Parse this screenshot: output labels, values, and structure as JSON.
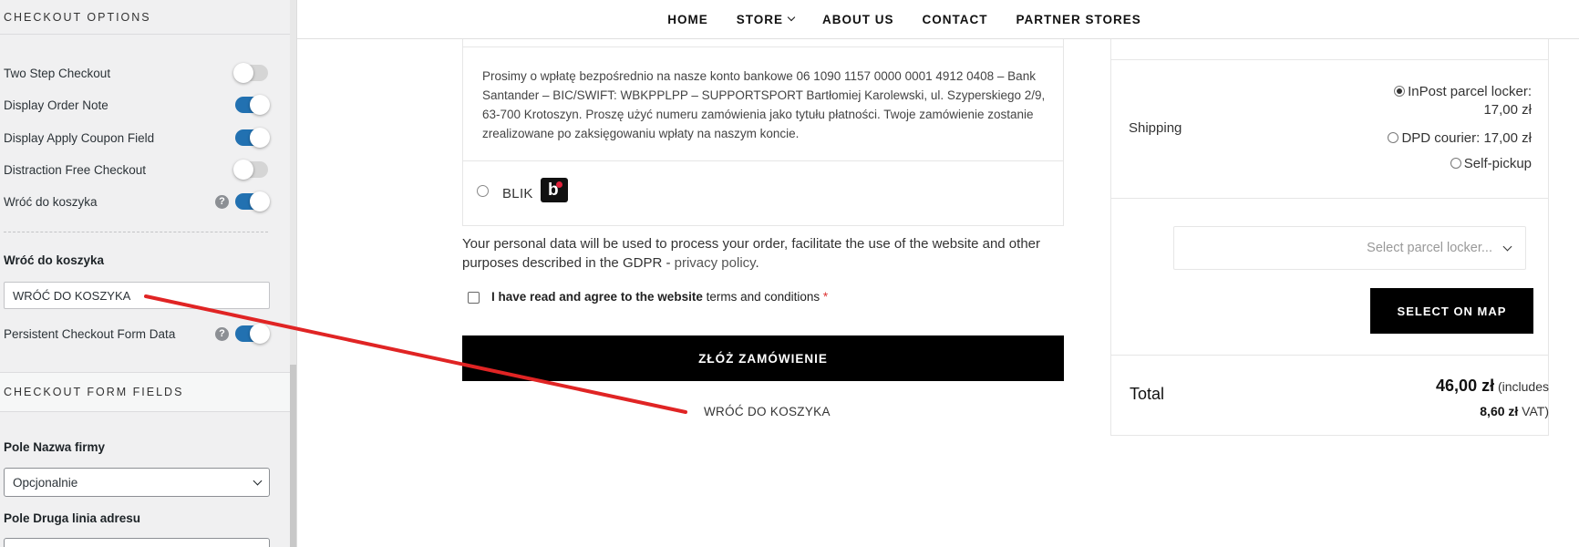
{
  "panel": {
    "section1_title": "CHECKOUT OPTIONS",
    "options": [
      {
        "label": "Two Step Checkout",
        "state": "off"
      },
      {
        "label": "Display Order Note",
        "state": "on"
      },
      {
        "label": "Display Apply Coupon Field",
        "state": "on"
      },
      {
        "label": "Distraction Free Checkout",
        "state": "off"
      },
      {
        "label": "Wróć do koszyka",
        "state": "on",
        "help": "?"
      }
    ],
    "back_field_label": "Wróć do koszyka",
    "back_field_value": "WRÓĆ DO KOSZYKA",
    "persistent_label": "Persistent Checkout Form Data",
    "persistent_state": "on",
    "persistent_help": "?",
    "section2_title": "CHECKOUT FORM FIELDS",
    "company_field_label": "Pole Nazwa firmy",
    "company_field_value": "Opcjonalnie",
    "address2_field_label": "Pole Druga linia adresu"
  },
  "nav": {
    "items": [
      "HOME",
      "STORE",
      "ABOUT US",
      "CONTACT",
      "PARTNER STORES"
    ]
  },
  "payment": {
    "bank_description": "Prosimy o wpłatę bezpośrednio na nasze konto bankowe 06 1090 1157 0000 0001 4912 0408 – Bank Santander – BIC/SWIFT: WBKPPLPP – SUPPORTSPORT Bartłomiej Karolewski, ul. Szyperskiego 2/9, 63-700 Krotoszyn. Proszę użyć numeru zamówienia jako tytułu płatności. Twoje zamówienie zostanie zrealizowane po zaksięgowaniu wpłaty na naszym koncie.",
    "blik_label": "BLIK",
    "blik_logo_letter": "b"
  },
  "privacy": {
    "text": "Your personal data will be used to process your order, facilitate the use of the website and other purposes described in the GDPR - ",
    "link": "privacy policy",
    "end": "."
  },
  "terms": {
    "text": "I have read and agree to the website ",
    "link": "terms and conditions",
    "required": "*"
  },
  "place_order_label": "ZŁÓŻ ZAMÓWIENIE",
  "back_link_label": "WRÓĆ DO KOSZYKA",
  "summary": {
    "shipping_label": "Shipping",
    "shipping_options": [
      {
        "line1": "InPost parcel locker:",
        "line2": "17,00 zł",
        "selected": true
      },
      {
        "line1": "DPD courier: 17,00 zł",
        "selected": false
      },
      {
        "line1": "Self-pickup",
        "selected": false
      }
    ],
    "locker_placeholder": "Select parcel locker...",
    "map_button_label": "SELECT ON MAP",
    "total_label": "Total",
    "total_amount": "46,00 zł",
    "total_includes": " (includes",
    "total_vat": "8,60 zł",
    "total_vat_suffix": " VAT)"
  },
  "colors": {
    "toggle_on": "#2271b1",
    "annotation_arrow": "#e02424"
  }
}
